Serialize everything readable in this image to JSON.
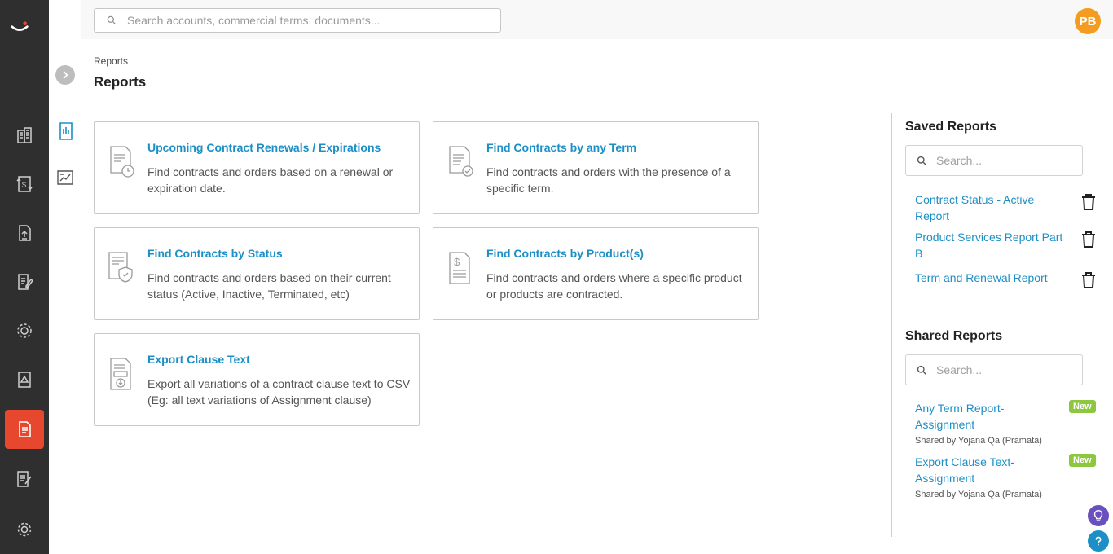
{
  "topbar": {
    "search_placeholder": "Search accounts, commercial terms, documents...",
    "avatar_initials": "PB"
  },
  "header": {
    "breadcrumb": "Reports",
    "title": "Reports"
  },
  "cards": [
    {
      "title": "Upcoming Contract Renewals / Expirations",
      "description": "Find contracts and orders based on a renewal or expiration date.",
      "icon": "calendar-document-icon"
    },
    {
      "title": "Find Contracts by any Term",
      "description": "Find contracts and orders with the presence of a specific term.",
      "icon": "checked-document-icon"
    },
    {
      "title": "Find Contracts by Status",
      "description": "Find contracts and orders based on their current status (Active, Inactive, Terminated, etc)",
      "icon": "shield-document-icon"
    },
    {
      "title": "Find Contracts by Product(s)",
      "description": "Find contracts and orders where a specific product or products are contracted.",
      "icon": "dollar-document-icon"
    },
    {
      "title": "Export Clause Text",
      "description": "Export all variations of a contract clause text to CSV (Eg: all text variations of Assignment clause)",
      "icon": "download-document-icon"
    }
  ],
  "saved_reports": {
    "title": "Saved Reports",
    "search_placeholder": "Search...",
    "items": [
      {
        "label": "Contract Status - Active Report"
      },
      {
        "label": "Product Services Report Part B"
      },
      {
        "label": "Term and Renewal Report"
      }
    ]
  },
  "shared_reports": {
    "title": "Shared Reports",
    "search_placeholder": "Search...",
    "items": [
      {
        "label": "Any Term Report- Assignment",
        "shared_by": "Shared by Yojana Qa (Pramata)",
        "badge": "New"
      },
      {
        "label": "Export Clause Text- Assignment",
        "shared_by": "Shared by Yojana Qa (Pramata)",
        "badge": "New"
      }
    ]
  },
  "colors": {
    "accent": "#1b8fc6",
    "active_nav": "#e8472f",
    "badge": "#8dc63f",
    "avatar": "#f39c1f"
  }
}
